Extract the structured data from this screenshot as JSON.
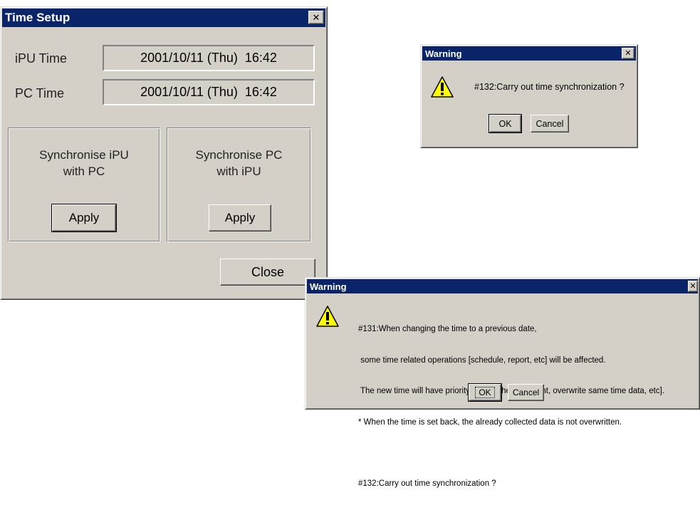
{
  "time_setup": {
    "title": "Time Setup",
    "ipu_label": "iPU Time",
    "ipu_value": "2001/10/11 (Thu)  16:42",
    "pc_label": "PC Time",
    "pc_value": "2001/10/11 (Thu)  16:42",
    "sync_ipu_line1": "Synchronise iPU",
    "sync_ipu_line2": "with PC",
    "sync_pc_line1": "Synchronise PC",
    "sync_pc_line2": "with iPU",
    "apply_label": "Apply",
    "close_label": "Close",
    "close_x": "✕"
  },
  "warning_small": {
    "title": "Warning",
    "message": "#132:Carry out time synchronization ?",
    "ok_label": "OK",
    "cancel_label": "Cancel",
    "close_x": "✕"
  },
  "warning_large": {
    "title": "Warning",
    "line1": "#131:When changing the time to a previous date,",
    "line2": " some time related operations [schedule, report, etc] will be affected.",
    "line3": " The new time will have priority [redo schedule event, overwrite same time data, etc].",
    "line4": "* When the time is set back, the already collected data is not overwritten.",
    "line5": "#132:Carry out time synchronization ?",
    "ok_label": "OK",
    "cancel_label": "Cancel",
    "close_x": "✕"
  },
  "icons": {
    "warning": "warning-icon",
    "close": "close-icon"
  }
}
